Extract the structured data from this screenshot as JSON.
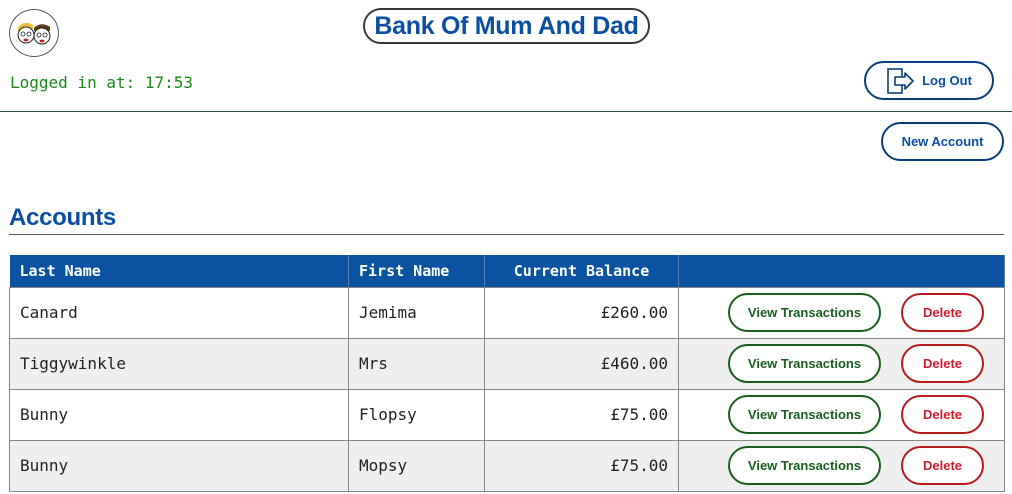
{
  "header": {
    "app_title": "Bank Of Mum And Dad",
    "logged_in_text": "Logged in at: 17:53",
    "logout_label": "Log Out",
    "avatar_icon": "two-faces-avatar-icon",
    "logout_icon": "exit-door-icon"
  },
  "toolbar": {
    "new_account_label": "New Account"
  },
  "accounts": {
    "title": "Accounts",
    "columns": [
      "Last Name",
      "First Name",
      "Current Balance",
      ""
    ],
    "view_label": "View Transactions",
    "delete_label": "Delete",
    "rows": [
      {
        "last_name": "Canard",
        "first_name": "Jemima",
        "balance": "£260.00"
      },
      {
        "last_name": "Tiggywinkle",
        "first_name": "Mrs",
        "balance": "£460.00"
      },
      {
        "last_name": "Bunny",
        "first_name": "Flopsy",
        "balance": "£75.00"
      },
      {
        "last_name": "Bunny",
        "first_name": "Mopsy",
        "balance": "£75.00"
      }
    ]
  },
  "colors": {
    "brand_blue": "#0b4ea2",
    "header_blue": "#0b52a0",
    "positive_green": "#1b8a1b",
    "danger_red": "#d11a2a"
  }
}
